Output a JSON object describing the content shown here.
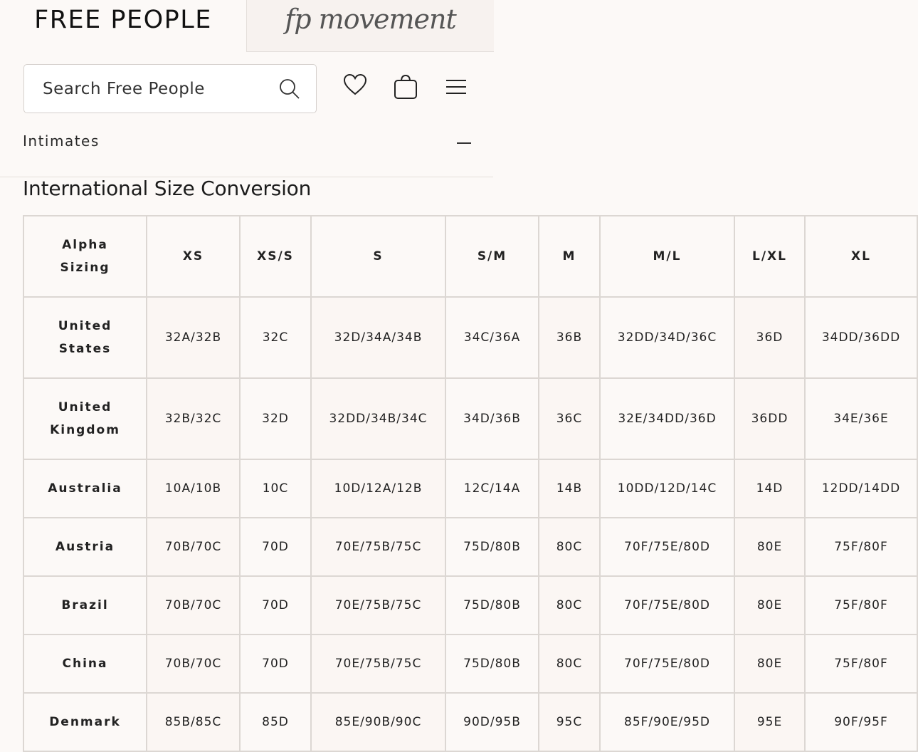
{
  "brands": {
    "primary": "FREE PEOPLE",
    "secondary": "fp movement"
  },
  "search": {
    "placeholder": "Search Free People"
  },
  "header_icons": [
    "heart-icon",
    "bag-icon",
    "menu-icon"
  ],
  "accordion": {
    "label": "Intimates",
    "state": "expanded"
  },
  "section": {
    "title": "International Size Conversion"
  },
  "table": {
    "headers": [
      "Alpha Sizing",
      "XS",
      "XS/S",
      "S",
      "S/M",
      "M",
      "M/L",
      "L/XL",
      "XL"
    ],
    "rows": [
      {
        "label": "United States",
        "values": [
          "32A/32B",
          "32C",
          "32D/34A/34B",
          "34C/36A",
          "36B",
          "32DD/34D/36C",
          "36D",
          "34DD/36DD"
        ]
      },
      {
        "label": "United Kingdom",
        "values": [
          "32B/32C",
          "32D",
          "32DD/34B/34C",
          "34D/36B",
          "36C",
          "32E/34DD/36D",
          "36DD",
          "34E/36E"
        ]
      },
      {
        "label": "Australia",
        "values": [
          "10A/10B",
          "10C",
          "10D/12A/12B",
          "12C/14A",
          "14B",
          "10DD/12D/14C",
          "14D",
          "12DD/14DD"
        ]
      },
      {
        "label": "Austria",
        "values": [
          "70B/70C",
          "70D",
          "70E/75B/75C",
          "75D/80B",
          "80C",
          "70F/75E/80D",
          "80E",
          "75F/80F"
        ]
      },
      {
        "label": "Brazil",
        "values": [
          "70B/70C",
          "70D",
          "70E/75B/75C",
          "75D/80B",
          "80C",
          "70F/75E/80D",
          "80E",
          "75F/80F"
        ]
      },
      {
        "label": "China",
        "values": [
          "70B/70C",
          "70D",
          "70E/75B/75C",
          "75D/80B",
          "80C",
          "70F/75E/80D",
          "80E",
          "75F/80F"
        ]
      },
      {
        "label": "Denmark",
        "values": [
          "85B/85C",
          "85D",
          "85E/90B/90C",
          "90D/95B",
          "95C",
          "85F/90E/95D",
          "95E",
          "90F/95F"
        ]
      }
    ]
  }
}
